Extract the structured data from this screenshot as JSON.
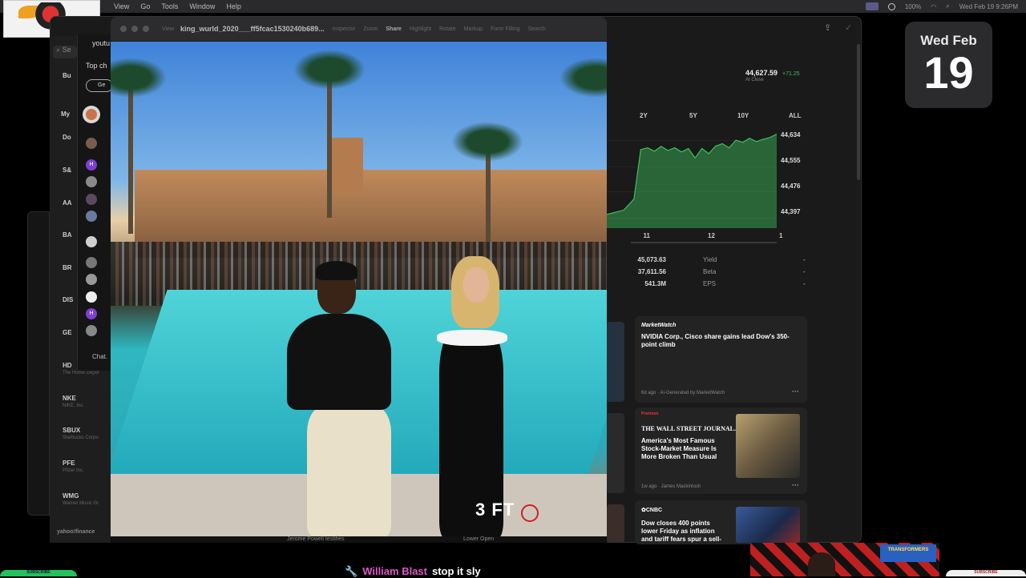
{
  "menubar": {
    "items": [
      "View",
      "Go",
      "Tools",
      "Window",
      "Help"
    ],
    "battery": "100%",
    "datetime": "Wed Feb 19  9:26PM"
  },
  "date_widget": {
    "dow": "Wed Feb",
    "day": "19"
  },
  "preview": {
    "title": "king_wurld_2020___ff5fcac1530240b689...",
    "toolbar": [
      "View",
      "Inspector",
      "Zoom",
      "Share",
      "Highlight",
      "Rotate",
      "Markup",
      "Form Filling",
      "Search"
    ],
    "sign_text": "3 FT",
    "below_strip": {
      "left": "Jerome Powell testifies",
      "right": "Lower Open"
    }
  },
  "sidebar": {
    "search_glyph": "Se",
    "items": [
      {
        "label": "Bu",
        "sub": ""
      },
      {
        "label": "My",
        "sub": ""
      },
      {
        "label": "Do",
        "sub": ""
      },
      {
        "label": "S&",
        "sub": ""
      },
      {
        "label": "AA",
        "sub": ""
      },
      {
        "label": "BA",
        "sub": ""
      },
      {
        "label": "BR",
        "sub": ""
      },
      {
        "label": "DIS",
        "sub": ""
      },
      {
        "label": "GE",
        "sub": ""
      },
      {
        "label": "HD",
        "sub": "The Home Depot"
      },
      {
        "label": "NKE",
        "sub": "NIKE, Inc."
      },
      {
        "label": "SBUX",
        "sub": "Starbucks Corpo"
      },
      {
        "label": "PFE",
        "sub": "Pfizer Inc."
      },
      {
        "label": "WMG",
        "sub": "Warner Music Gr"
      }
    ],
    "yahoo": "yahoo!finance"
  },
  "chat": {
    "header": "youtu",
    "top_chat": "Top ch",
    "chip": "Ge",
    "footer": "Chat."
  },
  "quote": {
    "value": "44,627.59",
    "change": "+71.25",
    "sub": "At Close"
  },
  "ranges": [
    "2Y",
    "5Y",
    "10Y",
    "ALL"
  ],
  "chart_data": {
    "type": "area",
    "x": [
      0,
      0.1,
      0.16,
      0.2,
      0.24,
      0.28,
      0.32,
      0.36,
      0.4,
      0.44,
      0.48,
      0.52,
      0.56,
      0.6,
      0.64,
      0.68,
      0.72,
      0.76,
      0.8,
      0.84,
      0.88,
      0.92,
      0.96,
      1.0
    ],
    "values": [
      44405,
      44418,
      44450,
      44595,
      44600,
      44590,
      44604,
      44592,
      44600,
      44588,
      44598,
      44570,
      44598,
      44583,
      44605,
      44612,
      44600,
      44622,
      44616,
      44628,
      44618,
      44625,
      44630,
      44640
    ],
    "ylim": [
      44365,
      44660
    ],
    "y_ticks": [
      "44,634",
      "44,555",
      "44,476",
      "44,397"
    ],
    "x_ticks": [
      "11",
      "12",
      "1"
    ],
    "color": "#3ec15c"
  },
  "stats": [
    {
      "value": "45,073.63",
      "key": "Yield",
      "dash": "-"
    },
    {
      "value": "37,611.56",
      "key": "Beta",
      "dash": "-"
    },
    {
      "value": "541.3M",
      "key": "EPS",
      "dash": "-"
    }
  ],
  "news": [
    {
      "source": "MarketWatch",
      "headline_1": "NVIDIA Corp., Cisco share gains lead Dow's 350-",
      "headline_2": "point climb",
      "meta": "6d ago · AI-Generated by MarketWatch"
    },
    {
      "badge": "Premium",
      "source": "THE WALL STREET JOURNAL.",
      "headline_1": "America's Most Famous",
      "headline_2": "Stock-Market Measure Is",
      "headline_3": "More Broken Than Usual",
      "meta": "1w ago · James Mackintosh"
    },
    {
      "source": "CNBC",
      "headline_1": "Dow closes 400 points",
      "headline_2": "lower Friday as inflation",
      "headline_3": "and tariff fears spur a sell-"
    }
  ],
  "bottom": {
    "chat_name": "William Blast",
    "chat_msg": "stop it sly",
    "cam_sign": "TRANSFORMERS",
    "green_pill": "SUBSCRIBE",
    "right_pill": "SUBSCRIBE"
  },
  "colors": {
    "accent_green": "#3ec15c",
    "chat_name": "#e056c8"
  }
}
